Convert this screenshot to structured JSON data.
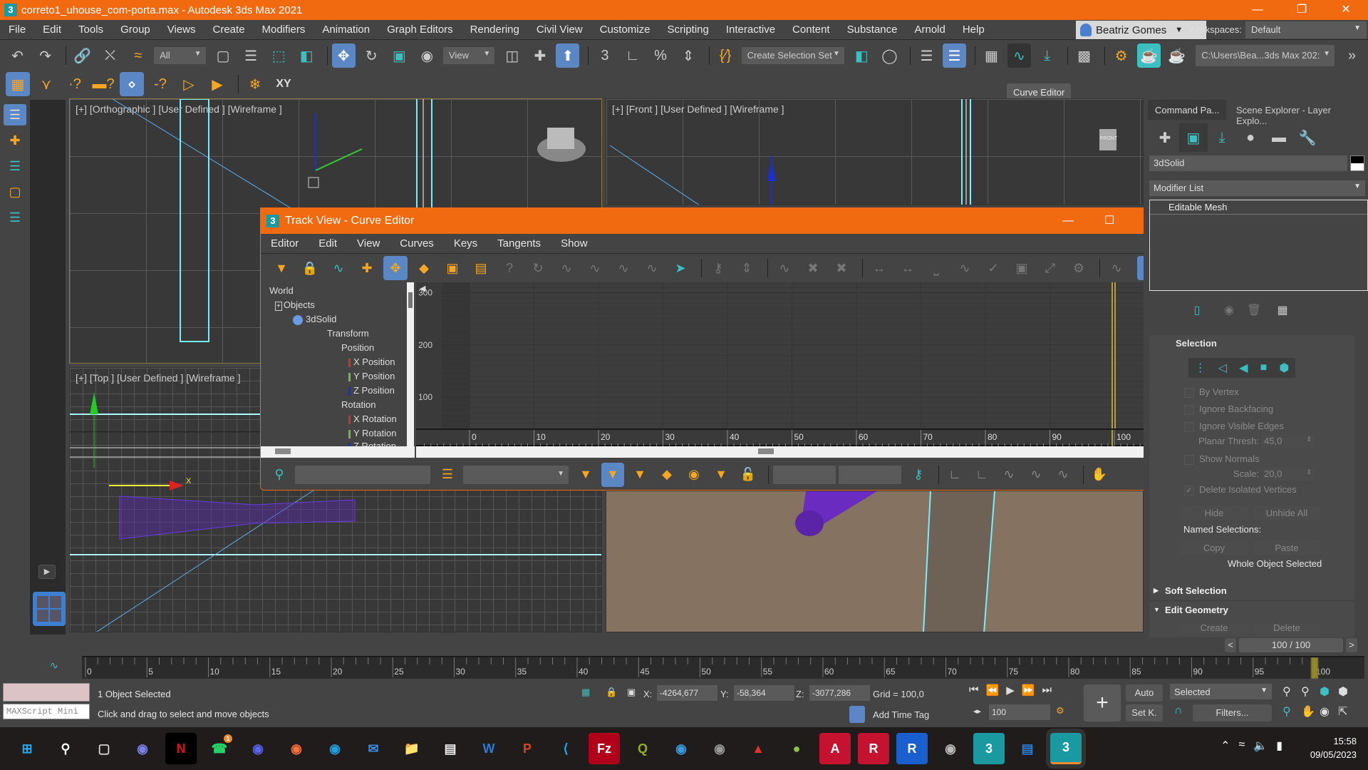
{
  "window": {
    "title": "correto1_uhouse_com-porta.max - Autodesk 3ds Max 2021",
    "app_icon": "3",
    "controls": [
      "minimize-icon",
      "restore-icon",
      "close-icon"
    ]
  },
  "menubar": {
    "items": [
      "File",
      "Edit",
      "Tools",
      "Group",
      "Views",
      "Create",
      "Modifiers",
      "Animation",
      "Graph Editors",
      "Rendering",
      "Civil View",
      "Customize",
      "Scripting",
      "Interactive",
      "Content",
      "Substance",
      "Arnold",
      "Help"
    ],
    "user": "Beatriz Gomes",
    "workspaces_label": "Workspaces:",
    "workspace": "Default"
  },
  "toolbar": {
    "selection_filter": "All",
    "reference_coord": "View",
    "selection_set_placeholder": "Create Selection Set",
    "project_path": "C:\\Users\\Bea...3ds Max 202:",
    "tooltip": "Curve Editor"
  },
  "viewports": {
    "top_left": "[+] [Orthographic ] [User Defined ] [Wireframe ]",
    "top_right": "[+] [Front ] [User Defined ] [Wireframe ]",
    "bottom_left": "[+] [Top ] [User Defined ] [Wireframe ]",
    "viewcube_label": "FRONT"
  },
  "curve_editor": {
    "title": "Track View - Curve Editor",
    "menu": [
      "Editor",
      "Edit",
      "View",
      "Curves",
      "Keys",
      "Tangents",
      "Show"
    ],
    "tree": {
      "world": "World",
      "objects": "Objects",
      "object": "3dSolid",
      "transform": "Transform",
      "position": "Position",
      "x_position": "X Position",
      "y_position": "Y Position",
      "z_position": "Z Position",
      "rotation": "Rotation",
      "x_rotation": "X Rotation",
      "y_rotation": "Y Rotation",
      "z_rotation": "Z Rotation"
    },
    "track_colors": {
      "x": "#c0392b",
      "y": "#7cb342",
      "z": "#1a2fd0"
    },
    "graph": {
      "y_ticks": [
        300,
        200,
        100
      ],
      "x_ticks": [
        0,
        10,
        20,
        30,
        40,
        50,
        60,
        70,
        80,
        90,
        100
      ],
      "current_frame": 100
    }
  },
  "command_panel": {
    "tabs": [
      "Command Pa...",
      "Scene Explorer - Layer Explo..."
    ],
    "object_name": "3dSolid",
    "modifier_list": "Modifier List",
    "stack_item": "Editable Mesh",
    "selection_rollout": "Selection",
    "by_vertex": "By Vertex",
    "ignore_backfacing": "Ignore Backfacing",
    "ignore_visible_edges": "Ignore Visible Edges",
    "planar_thresh_label": "Planar Thresh:",
    "planar_thresh": "45,0",
    "show_normals": "Show Normals",
    "scale_label": "Scale:",
    "scale": "20,0",
    "delete_isolated": "Delete Isolated Vertices",
    "delete_isolated_checked": true,
    "hide": "Hide",
    "unhide_all": "Unhide All",
    "named_selections": "Named Selections:",
    "copy": "Copy",
    "paste": "Paste",
    "whole_object": "Whole Object Selected",
    "soft_selection": "Soft Selection",
    "edit_geometry": "Edit Geometry",
    "create": "Create",
    "delete": "Delete"
  },
  "timeline": {
    "frame_display": "100 / 100",
    "ticks": [
      0,
      5,
      10,
      15,
      20,
      25,
      30,
      35,
      40,
      45,
      50,
      55,
      60,
      65,
      70,
      75,
      80,
      85,
      90,
      95,
      100
    ],
    "current": 100
  },
  "status": {
    "maxscript": "MAXScript Mini",
    "selected": "1 Object Selected",
    "prompt": "Click and drag to select and move objects",
    "x_label": "X:",
    "x": "-4264,677",
    "y_label": "Y:",
    "y": "-58,364",
    "z_label": "Z:",
    "z": "-3077,286",
    "grid": "Grid = 100,0",
    "add_time_tag": "Add Time Tag",
    "frame_field": "100",
    "auto": "Auto",
    "set_key": "Set K.",
    "key_filter": "Selected",
    "filters": "Filters..."
  },
  "taskbar": {
    "time": "15:58",
    "date": "09/05/2023",
    "apps": [
      "windows-start",
      "search",
      "task-view",
      "teams",
      "netflix",
      "whatsapp",
      "discord",
      "firefox",
      "edge",
      "mail",
      "file-explorer",
      "notepad",
      "word",
      "powerpoint",
      "vscode",
      "filezilla",
      "qgis",
      "globe-app",
      "gimp",
      "app-red",
      "app-green",
      "autocad",
      "revit-red",
      "revit",
      "app-grey",
      "3dsmax-2020",
      "document",
      "3dsmax-2021"
    ],
    "whatsapp_badge": "1"
  }
}
